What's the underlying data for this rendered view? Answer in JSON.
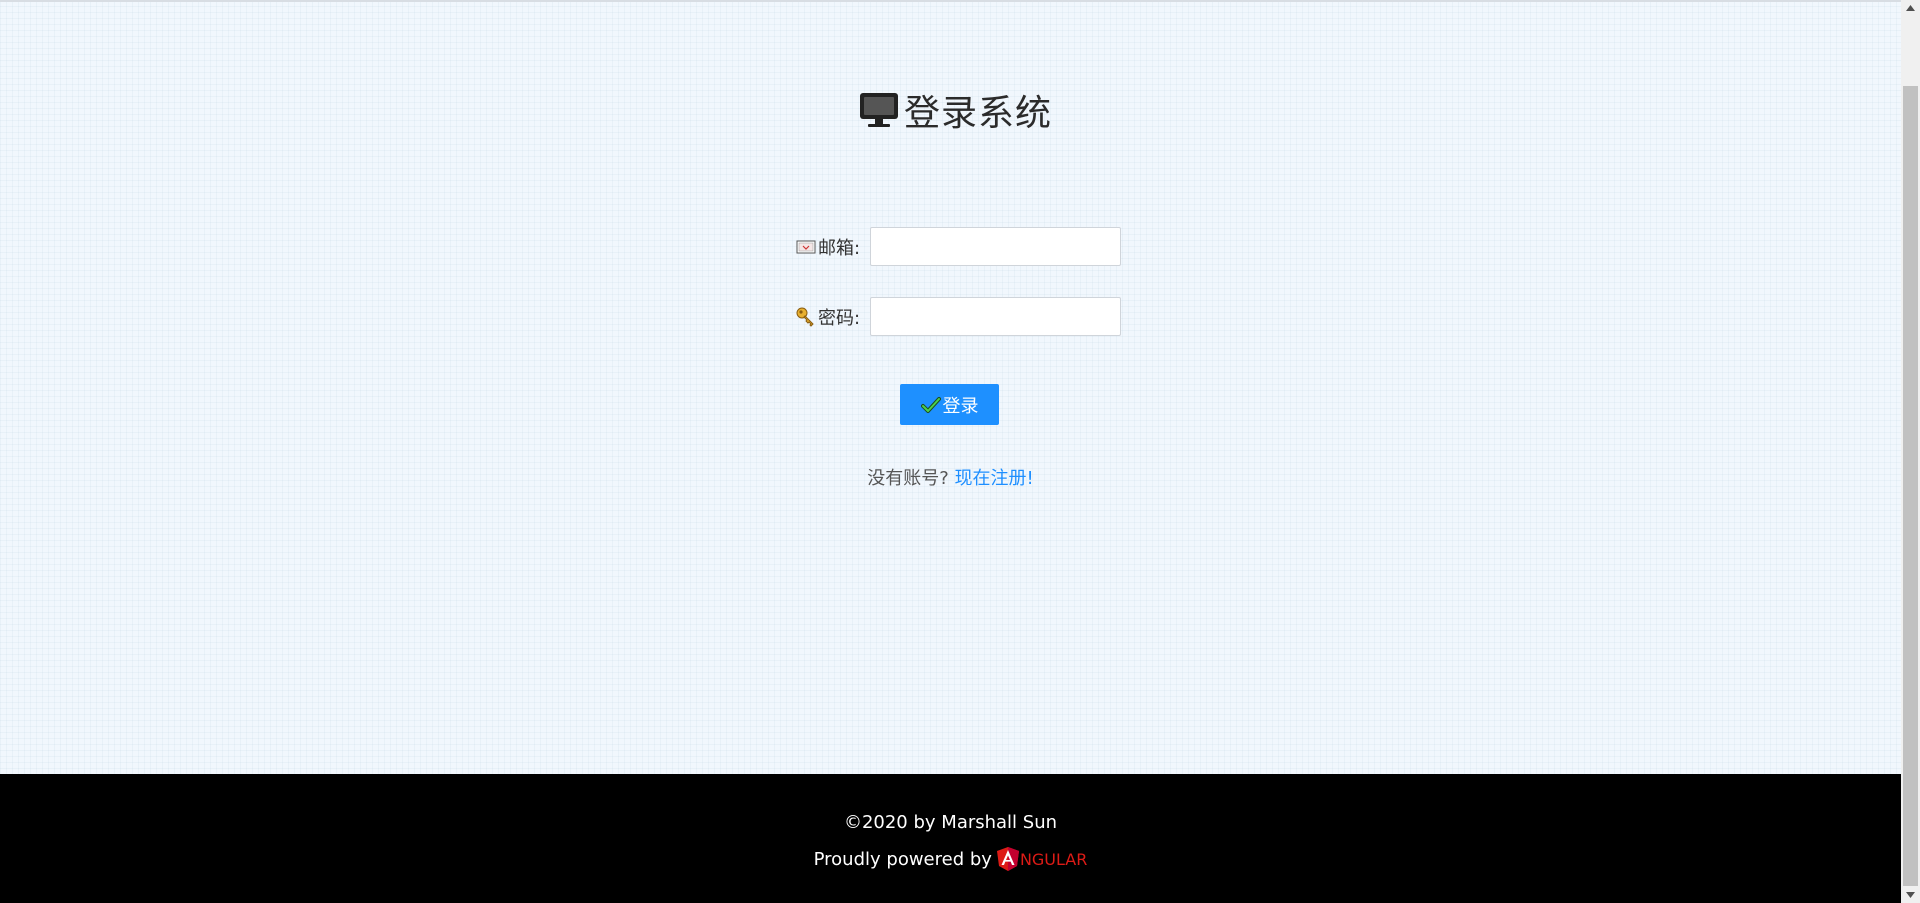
{
  "page": {
    "title": "登录系统",
    "title_icon": "monitor-icon"
  },
  "form": {
    "email_label": "邮箱:",
    "email_icon": "envelope-icon",
    "email_value": "",
    "email_placeholder": "",
    "password_label": "密码:",
    "password_icon": "key-icon",
    "password_value": "",
    "password_placeholder": "",
    "login_label": "登录",
    "login_icon": "checkmark-icon"
  },
  "register": {
    "prompt": "没有账号?",
    "link_label": "现在注册!"
  },
  "footer": {
    "copyright": "©2020 by Marshall Sun",
    "powered_by": "Proudly powered by",
    "angular_text": "NGULAR",
    "angular_icon": "angular-icon"
  },
  "colors": {
    "background": "#f1f7fd",
    "primary_button": "#1e90ff",
    "link": "#1e8fff",
    "footer_bg": "#000000",
    "angular_red": "#dd1b16"
  }
}
